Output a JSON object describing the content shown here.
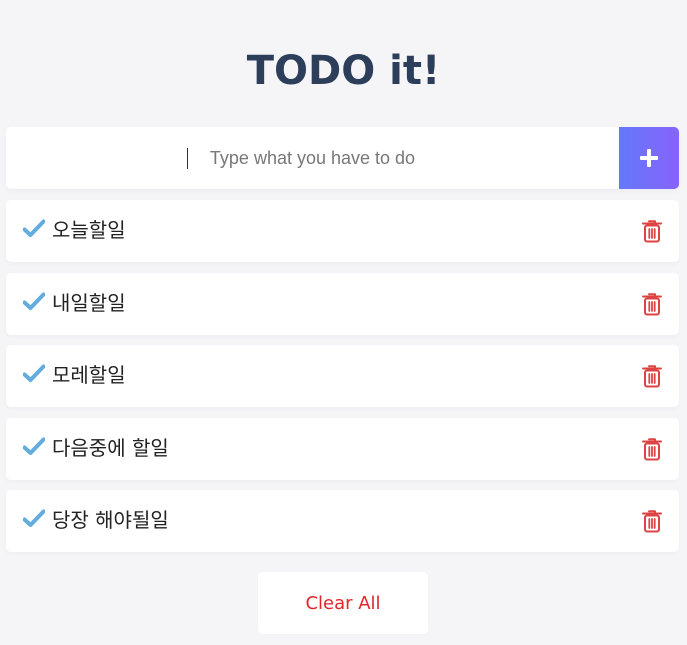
{
  "app": {
    "title": "TODO it!"
  },
  "input": {
    "placeholder": "Type what you have to do",
    "value": ""
  },
  "add_button": {
    "icon": "plus-icon"
  },
  "todos": [
    {
      "text": "오늘할일",
      "checked_icon": "check-icon",
      "delete_icon": "trash-icon"
    },
    {
      "text": "내일할일",
      "checked_icon": "check-icon",
      "delete_icon": "trash-icon"
    },
    {
      "text": "모레할일",
      "checked_icon": "check-icon",
      "delete_icon": "trash-icon"
    },
    {
      "text": "다음중에 할일",
      "checked_icon": "check-icon",
      "delete_icon": "trash-icon"
    },
    {
      "text": "당장 해야될일",
      "checked_icon": "check-icon",
      "delete_icon": "trash-icon"
    }
  ],
  "footer": {
    "clear_label": "Clear All"
  },
  "colors": {
    "title": "#2c3e5a",
    "accent_start": "#6478fb",
    "accent_end": "#8763fb",
    "check": "#62acde",
    "trash": "#de4343",
    "clear_text": "#e0262b",
    "background": "#f5f5f8"
  }
}
